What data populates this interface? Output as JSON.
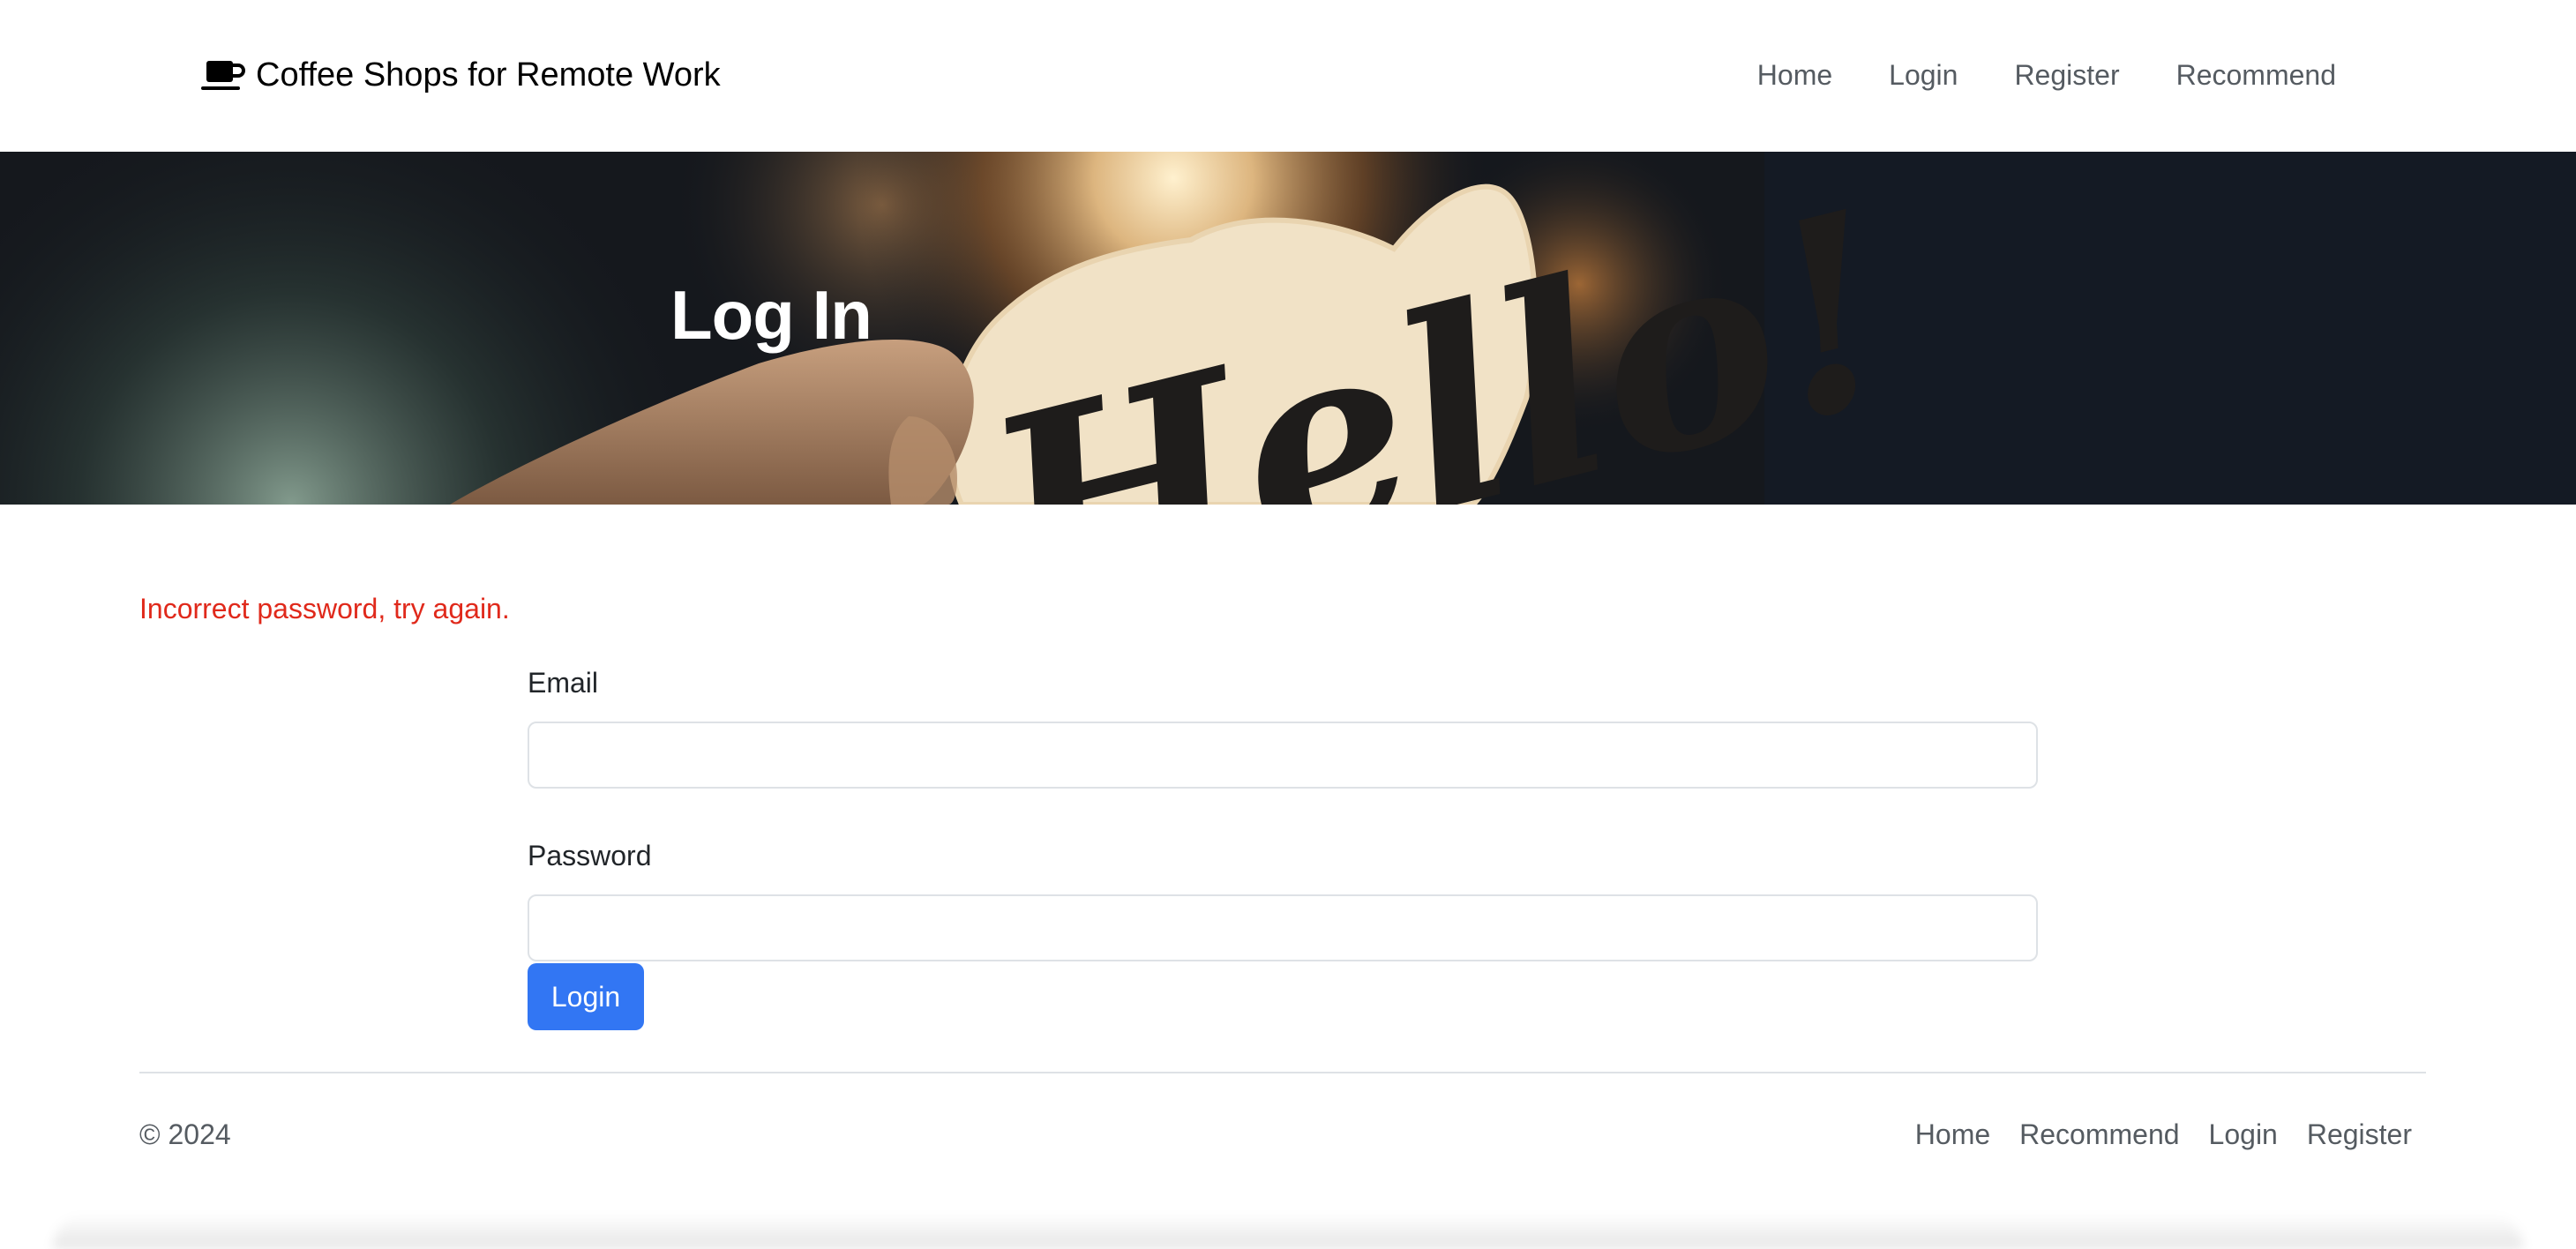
{
  "navbar": {
    "brand_text": "Coffee Shops for Remote Work",
    "brand_icon": "coffee-cup-icon",
    "links": [
      {
        "label": "Home"
      },
      {
        "label": "Login"
      },
      {
        "label": "Register"
      },
      {
        "label": "Recommend"
      }
    ]
  },
  "hero": {
    "title": "Log In",
    "image_text": "Hello!"
  },
  "alert": {
    "message": "Incorrect password, try again.",
    "color": "#e0291b"
  },
  "form": {
    "email_label": "Email",
    "email_value": "",
    "password_label": "Password",
    "password_value": "",
    "submit_label": "Login"
  },
  "footer": {
    "copyright": "© 2024",
    "links": [
      {
        "label": "Home"
      },
      {
        "label": "Recommend"
      },
      {
        "label": "Login"
      },
      {
        "label": "Register"
      }
    ]
  },
  "colors": {
    "primary": "#3276f3",
    "link": "#555b61",
    "error": "#e0291b"
  }
}
